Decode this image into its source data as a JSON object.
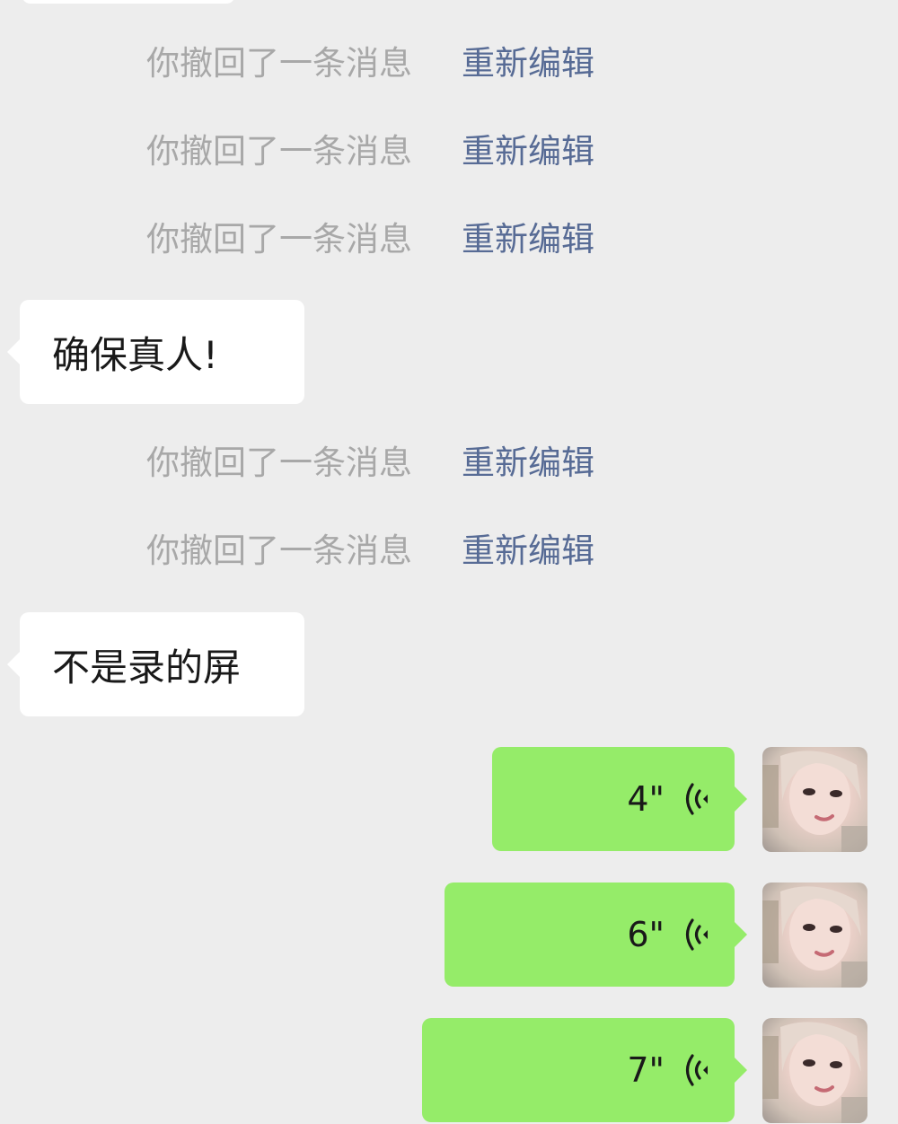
{
  "recalls": [
    {
      "text": "你撤回了一条消息",
      "action": "重新编辑"
    },
    {
      "text": "你撤回了一条消息",
      "action": "重新编辑"
    },
    {
      "text": "你撤回了一条消息",
      "action": "重新编辑"
    },
    {
      "text": "你撤回了一条消息",
      "action": "重新编辑"
    },
    {
      "text": "你撤回了一条消息",
      "action": "重新编辑"
    }
  ],
  "incoming": [
    {
      "text": "确保真人!"
    },
    {
      "text": "不是录的屏"
    }
  ],
  "voice_messages": [
    {
      "duration": "4\"",
      "icon": "voice-wave-icon"
    },
    {
      "duration": "6\"",
      "icon": "voice-wave-icon"
    },
    {
      "duration": "7\"",
      "icon": "voice-wave-icon"
    }
  ],
  "colors": {
    "background": "#ededed",
    "incoming_bubble": "#ffffff",
    "outgoing_bubble": "#95ec69",
    "system_text": "#a8a8a8",
    "link_text": "#576b95"
  }
}
